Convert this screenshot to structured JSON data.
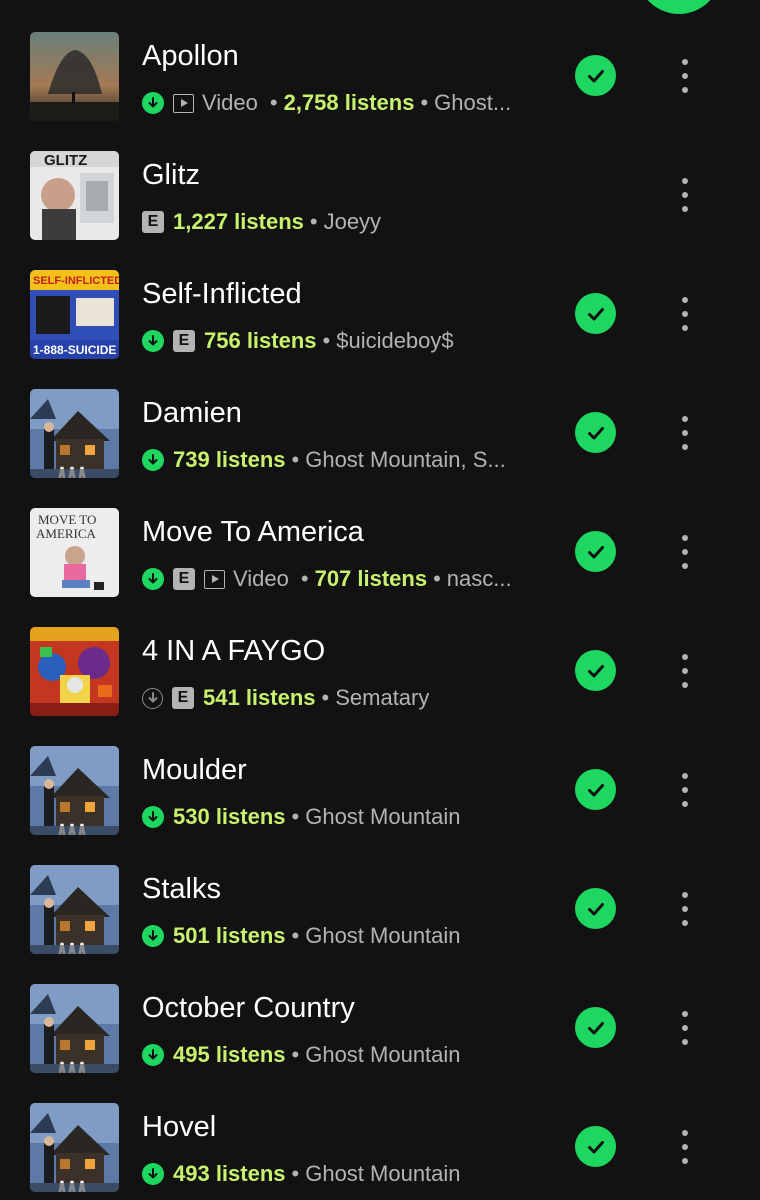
{
  "colors": {
    "background": "#121212",
    "accent_green": "#1ed760",
    "listens_color": "#c8f26e",
    "secondary_text": "#b3b3b3"
  },
  "tracks": [
    {
      "title": "Apollon",
      "downloaded": true,
      "explicit": false,
      "video": true,
      "video_label": "Video",
      "listens": "2,758 listens",
      "artist": "Ghost...",
      "saved": true,
      "art": "apollon"
    },
    {
      "title": "Glitz",
      "downloaded": false,
      "explicit": true,
      "video": false,
      "video_label": "",
      "listens": "1,227 listens",
      "artist": "Joeyy",
      "saved": false,
      "art": "glitz"
    },
    {
      "title": "Self-Inflicted",
      "downloaded": true,
      "explicit": true,
      "video": false,
      "video_label": "",
      "listens": "756 listens",
      "artist": "$uicideboy$",
      "saved": true,
      "art": "selfinflicted"
    },
    {
      "title": "Damien",
      "downloaded": true,
      "explicit": false,
      "video": false,
      "video_label": "",
      "listens": "739 listens",
      "artist": "Ghost Mountain, S...",
      "saved": true,
      "art": "cabin"
    },
    {
      "title": "Move To America",
      "downloaded": true,
      "explicit": true,
      "video": true,
      "video_label": "Video",
      "listens": "707 listens",
      "artist": "nasc...",
      "saved": true,
      "art": "movetoamerica"
    },
    {
      "title": "4 IN A FAYGO",
      "downloaded": "partial",
      "explicit": true,
      "video": false,
      "video_label": "",
      "listens": "541 listens",
      "artist": "Sematary",
      "saved": true,
      "art": "faygo"
    },
    {
      "title": "Moulder",
      "downloaded": true,
      "explicit": false,
      "video": false,
      "video_label": "",
      "listens": "530 listens",
      "artist": "Ghost Mountain",
      "saved": true,
      "art": "cabin"
    },
    {
      "title": "Stalks",
      "downloaded": true,
      "explicit": false,
      "video": false,
      "video_label": "",
      "listens": "501 listens",
      "artist": "Ghost Mountain",
      "saved": true,
      "art": "cabin"
    },
    {
      "title": "October Country",
      "downloaded": true,
      "explicit": false,
      "video": false,
      "video_label": "",
      "listens": "495 listens",
      "artist": "Ghost Mountain",
      "saved": true,
      "art": "cabin"
    },
    {
      "title": "Hovel",
      "downloaded": true,
      "explicit": false,
      "video": false,
      "video_label": "",
      "listens": "493 listens",
      "artist": "Ghost Mountain",
      "saved": true,
      "art": "cabin"
    }
  ],
  "labels": {
    "explicit_badge": "E"
  }
}
